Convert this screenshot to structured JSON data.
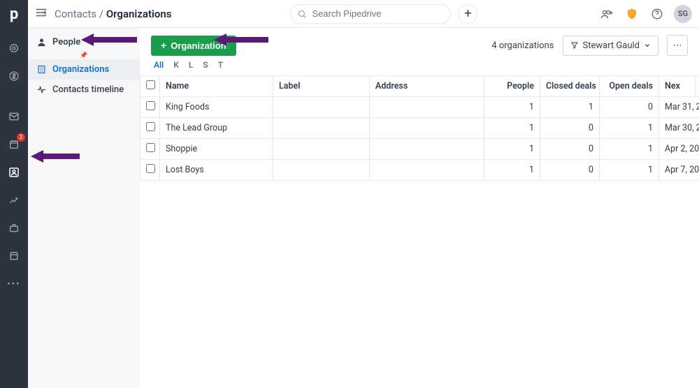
{
  "breadcrumb": {
    "root": "Contacts",
    "current": "Organizations"
  },
  "search": {
    "placeholder": "Search Pipedrive"
  },
  "header": {
    "avatar_initials": "SG"
  },
  "rail": {
    "badge_activities": "2"
  },
  "subsidebar": {
    "people": "People",
    "organizations": "Organizations",
    "timeline": "Contacts timeline"
  },
  "toolbar": {
    "add_label": "Organization",
    "count_text": "4 organizations",
    "filter_user": "Stewart Gauld"
  },
  "alpha_filter": [
    "All",
    "K",
    "L",
    "S",
    "T"
  ],
  "table": {
    "columns": [
      "Name",
      "Label",
      "Address",
      "People",
      "Closed deals",
      "Open deals",
      "Nex"
    ],
    "rows": [
      {
        "name": "King Foods",
        "label": "",
        "address": "",
        "people": 1,
        "closed": 1,
        "open": 0,
        "next": "Mar 31, 2"
      },
      {
        "name": "The Lead Group",
        "label": "",
        "address": "",
        "people": 1,
        "closed": 0,
        "open": 1,
        "next": "Mar 30, 2"
      },
      {
        "name": "Shoppie",
        "label": "",
        "address": "",
        "people": 1,
        "closed": 0,
        "open": 1,
        "next": "Apr 2, 20"
      },
      {
        "name": "Lost Boys",
        "label": "",
        "address": "",
        "people": 1,
        "closed": 0,
        "open": 1,
        "next": "Apr 7, 20"
      }
    ]
  }
}
